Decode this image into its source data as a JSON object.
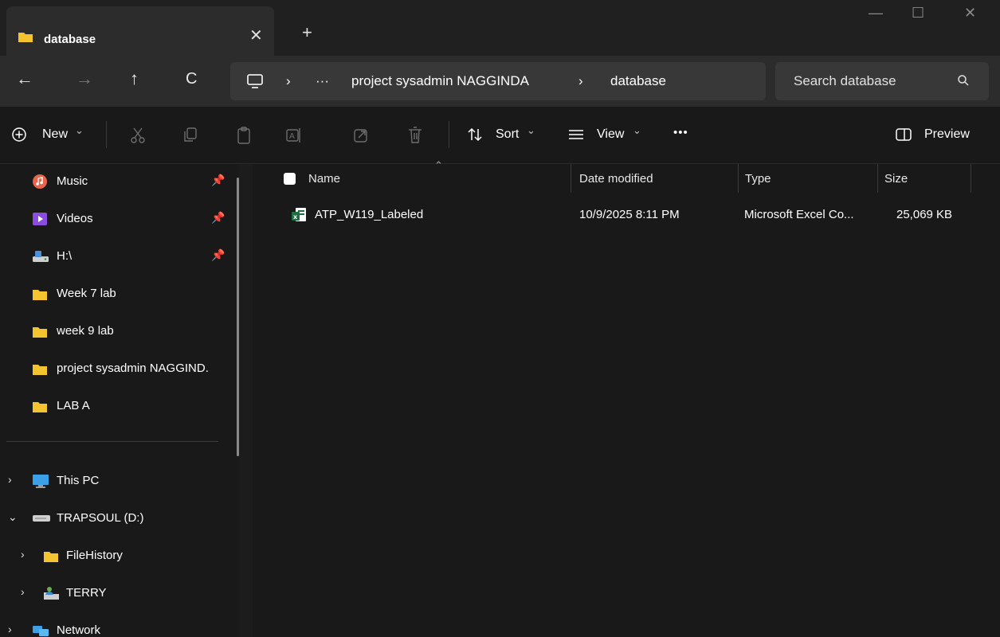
{
  "tab": {
    "title": "database",
    "close": "✕",
    "new_tab": "+"
  },
  "window": {
    "minimize": "—",
    "maximize": "☐",
    "close": "✕"
  },
  "nav": {
    "back": "←",
    "forward": "→",
    "up": "↑",
    "refresh": "C"
  },
  "address": {
    "separator": "›",
    "overflow": "···",
    "segments": [
      "project sysadmin NAGGINDA",
      "database"
    ]
  },
  "search": {
    "placeholder": "Search database"
  },
  "commandbar": {
    "new_label": "New",
    "sort_label": "Sort",
    "view_label": "View",
    "more": "•••",
    "preview_label": "Preview",
    "chevron": "⌄"
  },
  "sidebar": {
    "pinned": [
      {
        "label": "Music",
        "icon": "music-icon"
      },
      {
        "label": "Videos",
        "icon": "videos-icon"
      },
      {
        "label": "H:\\",
        "icon": "network-drive-icon"
      }
    ],
    "recent": [
      {
        "label": "Week 7 lab",
        "icon": "folder-icon"
      },
      {
        "label": "week 9 lab",
        "icon": "folder-icon"
      },
      {
        "label": "project sysadmin NAGGIND.",
        "icon": "folder-icon"
      },
      {
        "label": "LAB A",
        "icon": "folder-icon"
      }
    ],
    "tree": [
      {
        "label": "This PC",
        "icon": "monitor-icon",
        "chevron": "›"
      },
      {
        "label": "TRAPSOUL (D:)",
        "icon": "drive-icon",
        "chevron": "⌄"
      },
      {
        "label": "FileHistory",
        "icon": "folder-icon",
        "chevron": "›"
      },
      {
        "label": "TERRY",
        "icon": "user-folder-icon",
        "chevron": "›"
      },
      {
        "label": "Network",
        "icon": "network-icon",
        "chevron": "›"
      }
    ]
  },
  "file_list": {
    "columns": [
      "Name",
      "Date modified",
      "Type",
      "Size"
    ],
    "rows": [
      {
        "name": "ATP_W119_Labeled",
        "date": "10/9/2025 8:11 PM",
        "type": "Microsoft Excel Co...",
        "size": "25,069 KB"
      }
    ]
  },
  "colors": {
    "folder": "#f4c430",
    "excel": "#1d6f42",
    "accent": "#2c2c2c"
  }
}
